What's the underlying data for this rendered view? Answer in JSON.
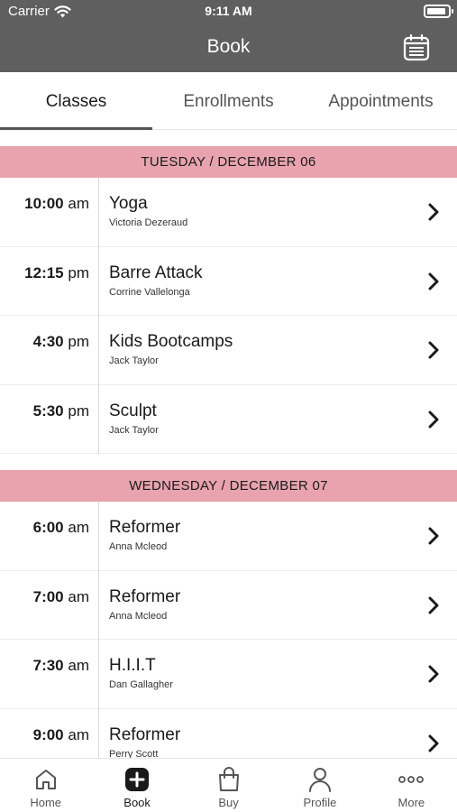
{
  "status_bar": {
    "carrier": "Carrier",
    "time": "9:11 AM",
    "battery_level": 0.9
  },
  "header": {
    "title": "Book",
    "calendar_icon": "calendar-icon"
  },
  "tabs": [
    {
      "label": "Classes",
      "active": true
    },
    {
      "label": "Enrollments",
      "active": false
    },
    {
      "label": "Appointments",
      "active": false
    }
  ],
  "days": [
    {
      "date_label": "TUESDAY / DECEMBER 06",
      "classes": [
        {
          "time": "10:00",
          "period": "am",
          "title": "Yoga",
          "instructor": "Victoria Dezeraud"
        },
        {
          "time": "12:15",
          "period": "pm",
          "title": "Barre Attack",
          "instructor": "Corrine Vallelonga"
        },
        {
          "time": "4:30",
          "period": "pm",
          "title": "Kids Bootcamps",
          "instructor": "Jack Taylor"
        },
        {
          "time": "5:30",
          "period": "pm",
          "title": "Sculpt",
          "instructor": "Jack Taylor"
        }
      ]
    },
    {
      "date_label": "WEDNESDAY / DECEMBER 07",
      "classes": [
        {
          "time": "6:00",
          "period": "am",
          "title": "Reformer",
          "instructor": "Anna Mcleod"
        },
        {
          "time": "7:00",
          "period": "am",
          "title": "Reformer",
          "instructor": "Anna Mcleod"
        },
        {
          "time": "7:30",
          "period": "am",
          "title": "H.I.I.T",
          "instructor": "Dan Gallagher"
        },
        {
          "time": "9:00",
          "period": "am",
          "title": "Reformer",
          "instructor": "Perry Scott"
        }
      ]
    }
  ],
  "bottom_tabs": [
    {
      "label": "Home",
      "icon": "home-icon",
      "active": false
    },
    {
      "label": "Book",
      "icon": "plus-square-icon",
      "active": true
    },
    {
      "label": "Buy",
      "icon": "shopping-bag-icon",
      "active": false
    },
    {
      "label": "Profile",
      "icon": "person-icon",
      "active": false
    },
    {
      "label": "More",
      "icon": "more-dots-icon",
      "active": false
    }
  ],
  "colors": {
    "header_bg": "#5f5f5f",
    "day_header_bg": "#e8a3af"
  }
}
